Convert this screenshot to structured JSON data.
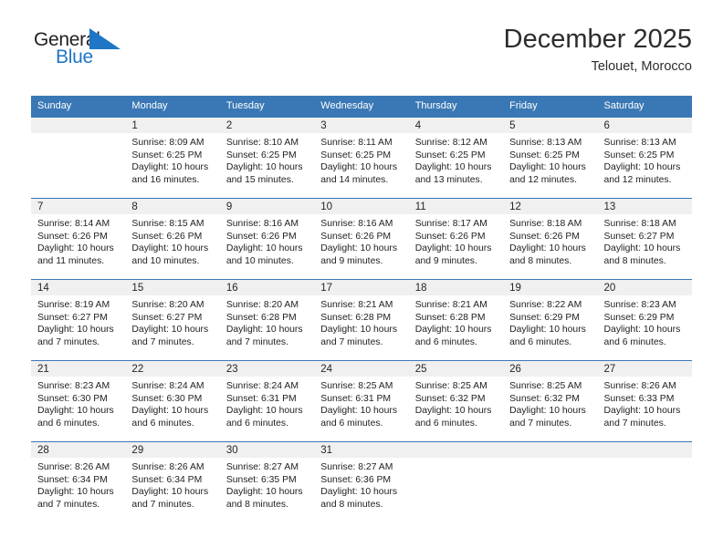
{
  "brand": {
    "name_part1": "General",
    "name_part2": "Blue",
    "flag_icon": "blue-triangle-flag-icon",
    "flag_color": "#1f76c4"
  },
  "header": {
    "title": "December 2025",
    "subtitle": "Telouet, Morocco"
  },
  "theme": {
    "header_blue": "#3a78b5",
    "daynum_band": "#f0f0f0",
    "text": "#222222",
    "accent_blue": "#1f76c4"
  },
  "weekday_headers": [
    "Sunday",
    "Monday",
    "Tuesday",
    "Wednesday",
    "Thursday",
    "Friday",
    "Saturday"
  ],
  "weeks": [
    [
      {
        "day": "",
        "sunrise": "",
        "sunset": "",
        "daylight_line1": "",
        "daylight_line2": ""
      },
      {
        "day": "1",
        "sunrise": "Sunrise: 8:09 AM",
        "sunset": "Sunset: 6:25 PM",
        "daylight_line1": "Daylight: 10 hours",
        "daylight_line2": "and 16 minutes."
      },
      {
        "day": "2",
        "sunrise": "Sunrise: 8:10 AM",
        "sunset": "Sunset: 6:25 PM",
        "daylight_line1": "Daylight: 10 hours",
        "daylight_line2": "and 15 minutes."
      },
      {
        "day": "3",
        "sunrise": "Sunrise: 8:11 AM",
        "sunset": "Sunset: 6:25 PM",
        "daylight_line1": "Daylight: 10 hours",
        "daylight_line2": "and 14 minutes."
      },
      {
        "day": "4",
        "sunrise": "Sunrise: 8:12 AM",
        "sunset": "Sunset: 6:25 PM",
        "daylight_line1": "Daylight: 10 hours",
        "daylight_line2": "and 13 minutes."
      },
      {
        "day": "5",
        "sunrise": "Sunrise: 8:13 AM",
        "sunset": "Sunset: 6:25 PM",
        "daylight_line1": "Daylight: 10 hours",
        "daylight_line2": "and 12 minutes."
      },
      {
        "day": "6",
        "sunrise": "Sunrise: 8:13 AM",
        "sunset": "Sunset: 6:25 PM",
        "daylight_line1": "Daylight: 10 hours",
        "daylight_line2": "and 12 minutes."
      }
    ],
    [
      {
        "day": "7",
        "sunrise": "Sunrise: 8:14 AM",
        "sunset": "Sunset: 6:26 PM",
        "daylight_line1": "Daylight: 10 hours",
        "daylight_line2": "and 11 minutes."
      },
      {
        "day": "8",
        "sunrise": "Sunrise: 8:15 AM",
        "sunset": "Sunset: 6:26 PM",
        "daylight_line1": "Daylight: 10 hours",
        "daylight_line2": "and 10 minutes."
      },
      {
        "day": "9",
        "sunrise": "Sunrise: 8:16 AM",
        "sunset": "Sunset: 6:26 PM",
        "daylight_line1": "Daylight: 10 hours",
        "daylight_line2": "and 10 minutes."
      },
      {
        "day": "10",
        "sunrise": "Sunrise: 8:16 AM",
        "sunset": "Sunset: 6:26 PM",
        "daylight_line1": "Daylight: 10 hours",
        "daylight_line2": "and 9 minutes."
      },
      {
        "day": "11",
        "sunrise": "Sunrise: 8:17 AM",
        "sunset": "Sunset: 6:26 PM",
        "daylight_line1": "Daylight: 10 hours",
        "daylight_line2": "and 9 minutes."
      },
      {
        "day": "12",
        "sunrise": "Sunrise: 8:18 AM",
        "sunset": "Sunset: 6:26 PM",
        "daylight_line1": "Daylight: 10 hours",
        "daylight_line2": "and 8 minutes."
      },
      {
        "day": "13",
        "sunrise": "Sunrise: 8:18 AM",
        "sunset": "Sunset: 6:27 PM",
        "daylight_line1": "Daylight: 10 hours",
        "daylight_line2": "and 8 minutes."
      }
    ],
    [
      {
        "day": "14",
        "sunrise": "Sunrise: 8:19 AM",
        "sunset": "Sunset: 6:27 PM",
        "daylight_line1": "Daylight: 10 hours",
        "daylight_line2": "and 7 minutes."
      },
      {
        "day": "15",
        "sunrise": "Sunrise: 8:20 AM",
        "sunset": "Sunset: 6:27 PM",
        "daylight_line1": "Daylight: 10 hours",
        "daylight_line2": "and 7 minutes."
      },
      {
        "day": "16",
        "sunrise": "Sunrise: 8:20 AM",
        "sunset": "Sunset: 6:28 PM",
        "daylight_line1": "Daylight: 10 hours",
        "daylight_line2": "and 7 minutes."
      },
      {
        "day": "17",
        "sunrise": "Sunrise: 8:21 AM",
        "sunset": "Sunset: 6:28 PM",
        "daylight_line1": "Daylight: 10 hours",
        "daylight_line2": "and 7 minutes."
      },
      {
        "day": "18",
        "sunrise": "Sunrise: 8:21 AM",
        "sunset": "Sunset: 6:28 PM",
        "daylight_line1": "Daylight: 10 hours",
        "daylight_line2": "and 6 minutes."
      },
      {
        "day": "19",
        "sunrise": "Sunrise: 8:22 AM",
        "sunset": "Sunset: 6:29 PM",
        "daylight_line1": "Daylight: 10 hours",
        "daylight_line2": "and 6 minutes."
      },
      {
        "day": "20",
        "sunrise": "Sunrise: 8:23 AM",
        "sunset": "Sunset: 6:29 PM",
        "daylight_line1": "Daylight: 10 hours",
        "daylight_line2": "and 6 minutes."
      }
    ],
    [
      {
        "day": "21",
        "sunrise": "Sunrise: 8:23 AM",
        "sunset": "Sunset: 6:30 PM",
        "daylight_line1": "Daylight: 10 hours",
        "daylight_line2": "and 6 minutes."
      },
      {
        "day": "22",
        "sunrise": "Sunrise: 8:24 AM",
        "sunset": "Sunset: 6:30 PM",
        "daylight_line1": "Daylight: 10 hours",
        "daylight_line2": "and 6 minutes."
      },
      {
        "day": "23",
        "sunrise": "Sunrise: 8:24 AM",
        "sunset": "Sunset: 6:31 PM",
        "daylight_line1": "Daylight: 10 hours",
        "daylight_line2": "and 6 minutes."
      },
      {
        "day": "24",
        "sunrise": "Sunrise: 8:25 AM",
        "sunset": "Sunset: 6:31 PM",
        "daylight_line1": "Daylight: 10 hours",
        "daylight_line2": "and 6 minutes."
      },
      {
        "day": "25",
        "sunrise": "Sunrise: 8:25 AM",
        "sunset": "Sunset: 6:32 PM",
        "daylight_line1": "Daylight: 10 hours",
        "daylight_line2": "and 6 minutes."
      },
      {
        "day": "26",
        "sunrise": "Sunrise: 8:25 AM",
        "sunset": "Sunset: 6:32 PM",
        "daylight_line1": "Daylight: 10 hours",
        "daylight_line2": "and 7 minutes."
      },
      {
        "day": "27",
        "sunrise": "Sunrise: 8:26 AM",
        "sunset": "Sunset: 6:33 PM",
        "daylight_line1": "Daylight: 10 hours",
        "daylight_line2": "and 7 minutes."
      }
    ],
    [
      {
        "day": "28",
        "sunrise": "Sunrise: 8:26 AM",
        "sunset": "Sunset: 6:34 PM",
        "daylight_line1": "Daylight: 10 hours",
        "daylight_line2": "and 7 minutes."
      },
      {
        "day": "29",
        "sunrise": "Sunrise: 8:26 AM",
        "sunset": "Sunset: 6:34 PM",
        "daylight_line1": "Daylight: 10 hours",
        "daylight_line2": "and 7 minutes."
      },
      {
        "day": "30",
        "sunrise": "Sunrise: 8:27 AM",
        "sunset": "Sunset: 6:35 PM",
        "daylight_line1": "Daylight: 10 hours",
        "daylight_line2": "and 8 minutes."
      },
      {
        "day": "31",
        "sunrise": "Sunrise: 8:27 AM",
        "sunset": "Sunset: 6:36 PM",
        "daylight_line1": "Daylight: 10 hours",
        "daylight_line2": "and 8 minutes."
      },
      {
        "day": "",
        "sunrise": "",
        "sunset": "",
        "daylight_line1": "",
        "daylight_line2": ""
      },
      {
        "day": "",
        "sunrise": "",
        "sunset": "",
        "daylight_line1": "",
        "daylight_line2": ""
      },
      {
        "day": "",
        "sunrise": "",
        "sunset": "",
        "daylight_line1": "",
        "daylight_line2": ""
      }
    ]
  ]
}
